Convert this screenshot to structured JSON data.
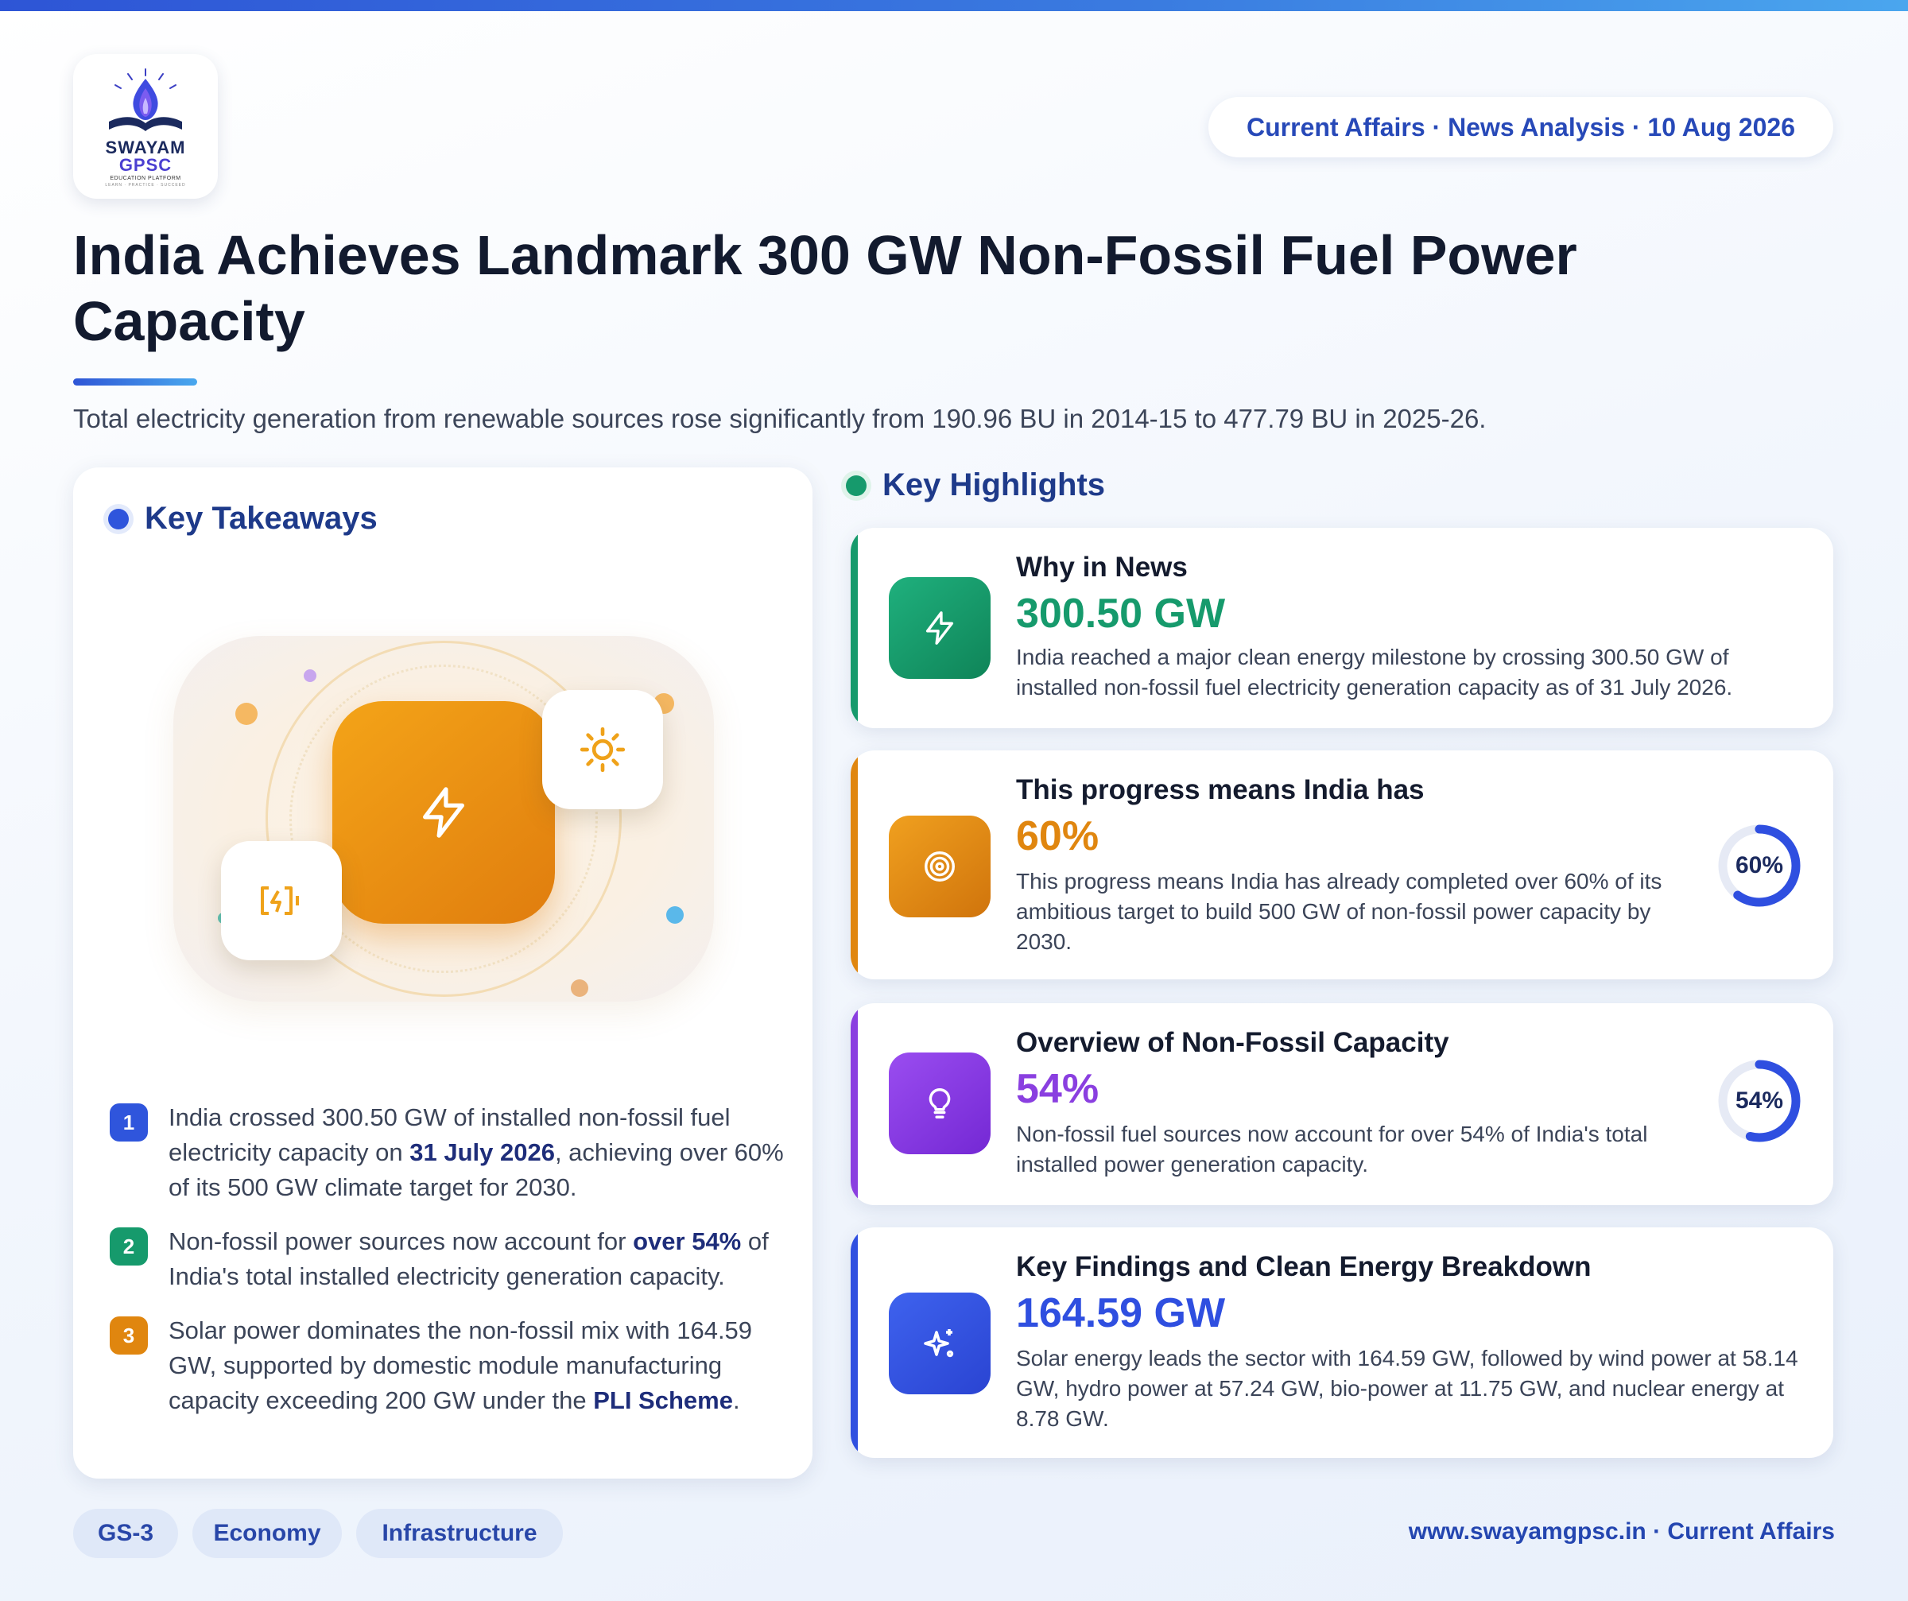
{
  "brand": {
    "logo_word_1": "SWAYAM",
    "logo_word_2": "GPSC",
    "logo_sub": "EDUCATION PLATFORM",
    "logo_tagline": "LEARN · PRACTICE · SUCCEED"
  },
  "header": {
    "date_pill": "Current Affairs · News Analysis · 10 Aug 2026",
    "title": "India Achieves Landmark 300 GW Non-Fossil Fuel Power Capacity",
    "subtitle": "Total electricity generation from renewable sources rose significantly from 190.96 BU in 2014-15 to 477.79 BU in 2025-26."
  },
  "takeaways": {
    "heading": "Key Takeaways",
    "items": [
      {
        "num": "1",
        "pre": "India crossed 300.50 GW of installed non-fossil fuel electricity capacity on ",
        "bold": "31 July 2026",
        "post": ", achieving over 60% of its 500 GW climate target for 2030."
      },
      {
        "num": "2",
        "pre": "Non-fossil power sources now account for ",
        "bold": "over 54%",
        "post": " of India's total installed electricity generation capacity."
      },
      {
        "num": "3",
        "pre": "Solar power dominates the non-fossil mix with 164.59 GW, supported by domestic module manufacturing capacity exceeding 200 GW under the ",
        "bold": "PLI Scheme",
        "post": "."
      }
    ]
  },
  "highlights": {
    "heading": "Key Highlights",
    "cards": [
      {
        "title": "Why in News",
        "value": "300.50 GW",
        "desc": "India reached a major clean energy milestone by crossing 300.50 GW of installed non-fossil fuel electricity generation capacity as of 31 July 2026.",
        "color": "#169a6c",
        "icon": "bolt-icon"
      },
      {
        "title": "This progress means India has",
        "value": "60%",
        "desc": "This progress means India has already completed over 60% of its ambitious target to build 500 GW of non-fossil power capacity by 2030.",
        "color": "#e0860f",
        "icon": "target-icon",
        "donut_label": "60%",
        "donut_fraction": 0.6
      },
      {
        "title": "Overview of Non-Fossil Capacity",
        "value": "54%",
        "desc": "Non-fossil fuel sources now account for over 54% of India's total installed power generation capacity.",
        "color": "#8a3fe0",
        "icon": "lightbulb-icon",
        "donut_label": "54%",
        "donut_fraction": 0.54
      },
      {
        "title": "Key Findings and Clean Energy Breakdown",
        "value": "164.59 GW",
        "desc": "Solar energy leads the sector with 164.59 GW, followed by wind power at 58.14 GW, hydro power at 57.24 GW, bio-power at 11.75 GW, and nuclear energy at 8.78 GW.",
        "color": "#3050e0",
        "icon": "sparkles-icon"
      }
    ]
  },
  "tags": [
    "GS-3",
    "Economy",
    "Infrastructure"
  ],
  "footer": "www.swayamgpsc.in · Current Affairs"
}
